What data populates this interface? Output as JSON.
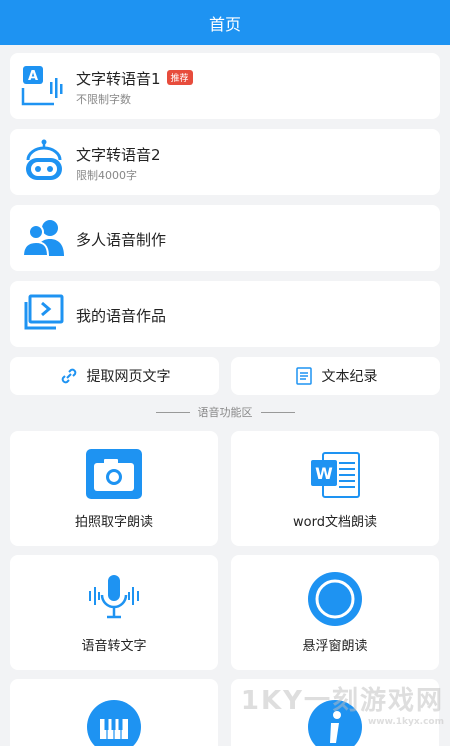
{
  "header": {
    "title": "首页"
  },
  "cards": [
    {
      "title": "文字转语音1",
      "sub": "不限制字数",
      "badge": "推荐",
      "icon": "text-to-speech-icon"
    },
    {
      "title": "文字转语音2",
      "sub": "限制4000字",
      "icon": "robot-icon"
    },
    {
      "title": "多人语音制作",
      "icon": "users-icon"
    },
    {
      "title": "我的语音作品",
      "icon": "folder-play-icon"
    }
  ],
  "pills": [
    {
      "label": "提取网页文字",
      "icon": "link-icon"
    },
    {
      "label": "文本纪录",
      "icon": "document-icon"
    }
  ],
  "section": {
    "title": "语音功能区"
  },
  "tiles": [
    {
      "label": "拍照取字朗读",
      "icon": "camera-icon"
    },
    {
      "label": "word文档朗读",
      "icon": "word-icon"
    },
    {
      "label": "语音转文字",
      "icon": "microphone-icon"
    },
    {
      "label": "悬浮窗朗读",
      "icon": "circle-icon"
    },
    {
      "label": "",
      "icon": "piano-icon"
    },
    {
      "label": "",
      "icon": "info-icon"
    }
  ],
  "watermark": {
    "text": "1KY一刻游戏网",
    "url": "www.1kyx.com"
  },
  "colors": {
    "primary": "#1e93f2",
    "badge": "#e74c3c"
  }
}
